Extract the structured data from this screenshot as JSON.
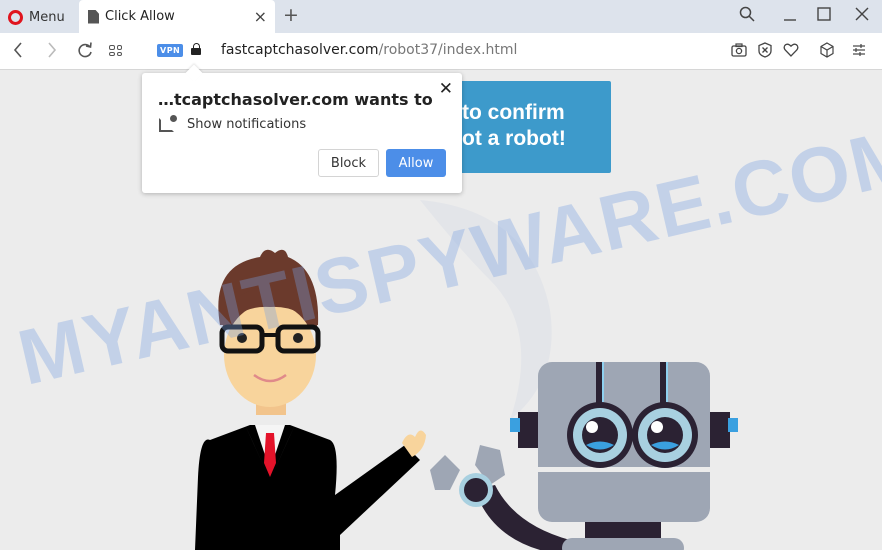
{
  "browser": {
    "menu_label": "Menu",
    "tab_title": "Click Allow",
    "tab_close": "×",
    "new_tab": "+",
    "window_controls": [
      "search-icon",
      "minimize-icon",
      "maximize-icon",
      "close-icon"
    ]
  },
  "address_bar": {
    "vpn_badge": "VPN",
    "url_domain": "fastcaptchasolver.com",
    "url_path": "/robot37/index.html",
    "right_icons": [
      "camera-icon",
      "adblock-icon",
      "heart-icon",
      "cube-icon",
      "settings-sliders-icon"
    ]
  },
  "permission_popup": {
    "title": "…tcaptchasolver.com wants to",
    "permission": "Show notifications",
    "block_label": "Block",
    "allow_label": "Allow",
    "close": "✕"
  },
  "page": {
    "banner_line1": "to confirm",
    "banner_line2": "ot a robot!",
    "watermark": "MYANTISPYWARE.COM",
    "colors": {
      "banner": "#3d9acb",
      "allow": "#4c8ee8",
      "tie": "#e4132a",
      "robot_body": "#9ea6b4"
    }
  }
}
